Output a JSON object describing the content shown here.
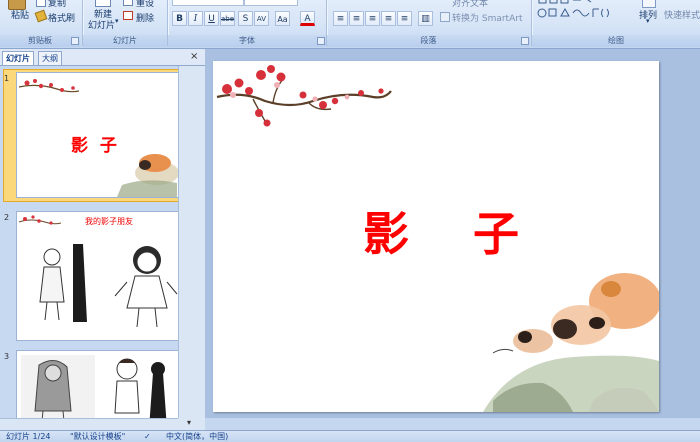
{
  "ribbon": {
    "clipboard": {
      "paste": "粘贴",
      "copy": "复制",
      "format_painter": "格式刷",
      "group": "剪贴板"
    },
    "slides": {
      "new_slide_line1": "新建",
      "new_slide_line2": "幻灯片",
      "reset": "重设",
      "delete": "删除",
      "group": "幻灯片"
    },
    "font": {
      "bold": "B",
      "italic": "I",
      "underline": "U",
      "strike": "abe",
      "shadow": "S",
      "spacing": "AV",
      "case": "Aa",
      "color": "A",
      "group": "字体"
    },
    "paragraph": {
      "align_text": "对齐文本",
      "convert_smartart": "转换为 SmartArt",
      "group": "段落"
    },
    "drawing": {
      "arrange": "排列",
      "quick_styles": "快速样式",
      "group": "绘图"
    }
  },
  "panel": {
    "tabs": [
      "幻灯片",
      "大纲"
    ],
    "close": "×",
    "thumbnails": [
      {
        "number": "1",
        "title": "影  子"
      },
      {
        "number": "2",
        "caption": "我的影子朋友"
      },
      {
        "number": "3"
      }
    ]
  },
  "slide": {
    "title": "影    子"
  },
  "status": {
    "slide_counter": "幻灯片 1/24",
    "theme": "\"默认设计模板\"",
    "language": "中文(简体，中国)"
  },
  "colors": {
    "title_red": "#ff0000",
    "selection": "#fbd97a",
    "ribbon": "#d4e3f6"
  }
}
